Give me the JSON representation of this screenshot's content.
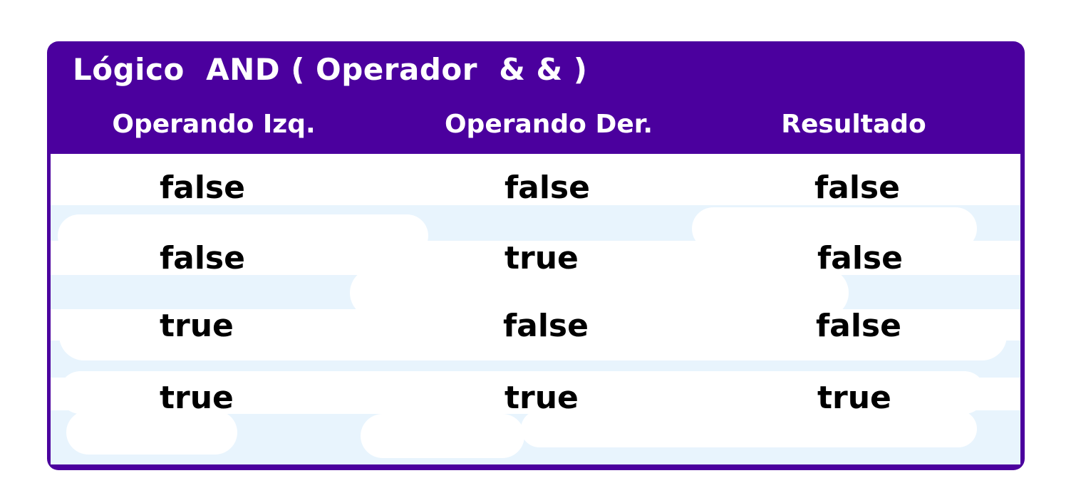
{
  "title": "Lógico  AND ( Operador  & & )",
  "columns": [
    "Operando Izq.",
    "Operando Der.",
    "Resultado"
  ],
  "rows": [
    [
      "false",
      "false",
      "false"
    ],
    [
      "false",
      "true",
      "false"
    ],
    [
      "true",
      "false",
      "false"
    ],
    [
      "true",
      "true",
      "true"
    ]
  ],
  "colors": {
    "header": "#4b009e",
    "stripe": "#e8f4fd",
    "text": "#000000",
    "header_text": "#ffffff"
  }
}
